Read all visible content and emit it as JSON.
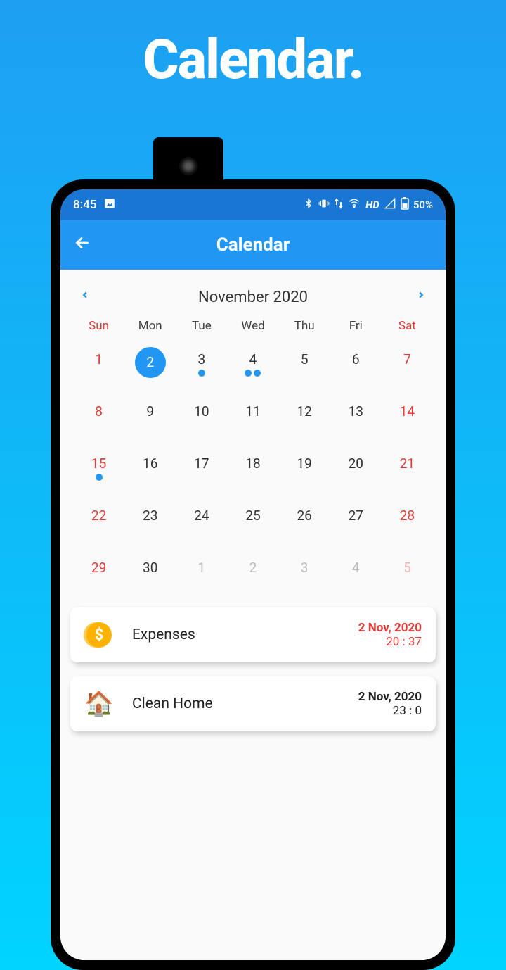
{
  "promo_title": "Calendar.",
  "status": {
    "time": "8:45",
    "hd": "HD",
    "battery": "50%"
  },
  "appbar": {
    "title": "Calendar"
  },
  "calendar": {
    "month_label": "November 2020",
    "days_of_week": [
      "Sun",
      "Mon",
      "Tue",
      "Wed",
      "Thu",
      "Fri",
      "Sat"
    ],
    "cells": [
      {
        "n": "1",
        "red": true,
        "dots": 0
      },
      {
        "n": "2",
        "selected": true,
        "dots": 0
      },
      {
        "n": "3",
        "dots": 1
      },
      {
        "n": "4",
        "dots": 2
      },
      {
        "n": "5",
        "dots": 0
      },
      {
        "n": "6",
        "dots": 0
      },
      {
        "n": "7",
        "red": true,
        "dots": 0
      },
      {
        "n": "8",
        "red": true,
        "dots": 0
      },
      {
        "n": "9",
        "dots": 0
      },
      {
        "n": "10",
        "dots": 0
      },
      {
        "n": "11",
        "dots": 0
      },
      {
        "n": "12",
        "dots": 0
      },
      {
        "n": "13",
        "dots": 0
      },
      {
        "n": "14",
        "red": true,
        "dots": 0
      },
      {
        "n": "15",
        "red": true,
        "dots": 1
      },
      {
        "n": "16",
        "dots": 0
      },
      {
        "n": "17",
        "dots": 0
      },
      {
        "n": "18",
        "dots": 0
      },
      {
        "n": "19",
        "dots": 0
      },
      {
        "n": "20",
        "dots": 0
      },
      {
        "n": "21",
        "red": true,
        "dots": 0
      },
      {
        "n": "22",
        "red": true,
        "dots": 0
      },
      {
        "n": "23",
        "dots": 0
      },
      {
        "n": "24",
        "dots": 0
      },
      {
        "n": "25",
        "dots": 0
      },
      {
        "n": "26",
        "dots": 0
      },
      {
        "n": "27",
        "dots": 0
      },
      {
        "n": "28",
        "red": true,
        "dots": 0
      },
      {
        "n": "29",
        "red": true,
        "dots": 0
      },
      {
        "n": "30",
        "dots": 0
      },
      {
        "n": "1",
        "other": true,
        "dots": 0
      },
      {
        "n": "2",
        "other": true,
        "dots": 0
      },
      {
        "n": "3",
        "other": true,
        "dots": 0
      },
      {
        "n": "4",
        "other": true,
        "dots": 0
      },
      {
        "n": "5",
        "other": true,
        "red": true,
        "dots": 0
      }
    ]
  },
  "events": [
    {
      "icon": "coin",
      "title": "Expenses",
      "date": "2 Nov, 2020",
      "time": "20 : 37",
      "overdue": true
    },
    {
      "icon": "house",
      "title": "Clean Home",
      "date": "2 Nov, 2020",
      "time": "23 : 0",
      "overdue": false
    }
  ]
}
